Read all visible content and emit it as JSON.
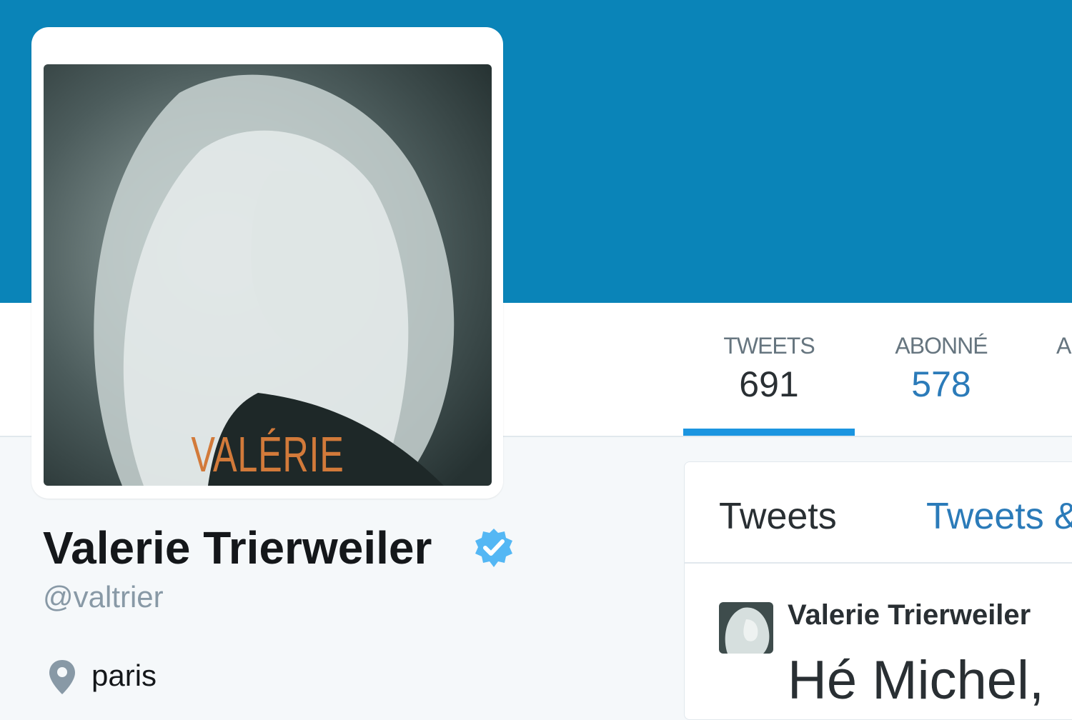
{
  "colors": {
    "banner": "#0a84b8",
    "accent": "#1b95e0",
    "link": "#2b7bb9",
    "caption": "#d27a3a"
  },
  "avatar": {
    "caption": "VALÉRIE"
  },
  "stats": {
    "tweets_label": "TWEETS",
    "tweets_value": "691",
    "following_label": "ABONNÉ",
    "following_value": "578",
    "more_label": "A"
  },
  "timeline": {
    "tabs": [
      "Tweets",
      "Tweets &"
    ],
    "tweet": {
      "author": "Valerie Trierweiler",
      "text": "Hé Michel,"
    }
  },
  "profile": {
    "name": "Valerie Trierweiler",
    "handle": "@valtrier",
    "location": "paris"
  },
  "icons": {
    "verified": "verified-badge-icon",
    "location": "map-pin-icon"
  }
}
